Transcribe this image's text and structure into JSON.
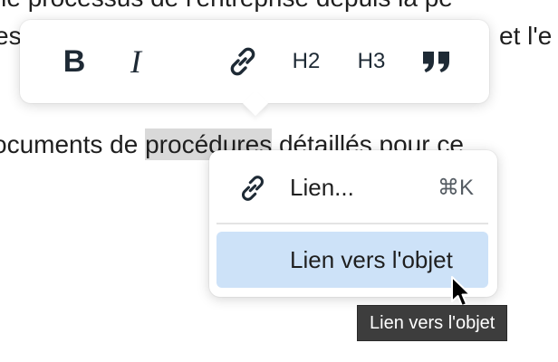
{
  "document": {
    "line1": "et le processus de l'entreprise depuis la pé",
    "line2_left": "es",
    "line2_right": "et l'e",
    "line3_before": "ocuments de ",
    "line3_highlight": "procédures",
    "line3_after": " détaillés pour ce"
  },
  "toolbar": {
    "bold_label": "B",
    "italic_label": "I",
    "link_icon": "link-icon",
    "h2_label": "H2",
    "h3_label": "H3",
    "quote_icon": "quote-icon"
  },
  "link_menu": {
    "items": [
      {
        "label": "Lien...",
        "shortcut": "⌘K",
        "icon": "link-icon"
      },
      {
        "label": "Lien vers l'objet",
        "highlighted": true
      }
    ]
  },
  "tooltip": {
    "text": "Lien vers l'objet"
  },
  "colors": {
    "highlight": "#d9d9d9",
    "menu_selected": "#cde2f8",
    "tooltip_bg": "#3d3d3d",
    "icon": "#1e2a35"
  }
}
